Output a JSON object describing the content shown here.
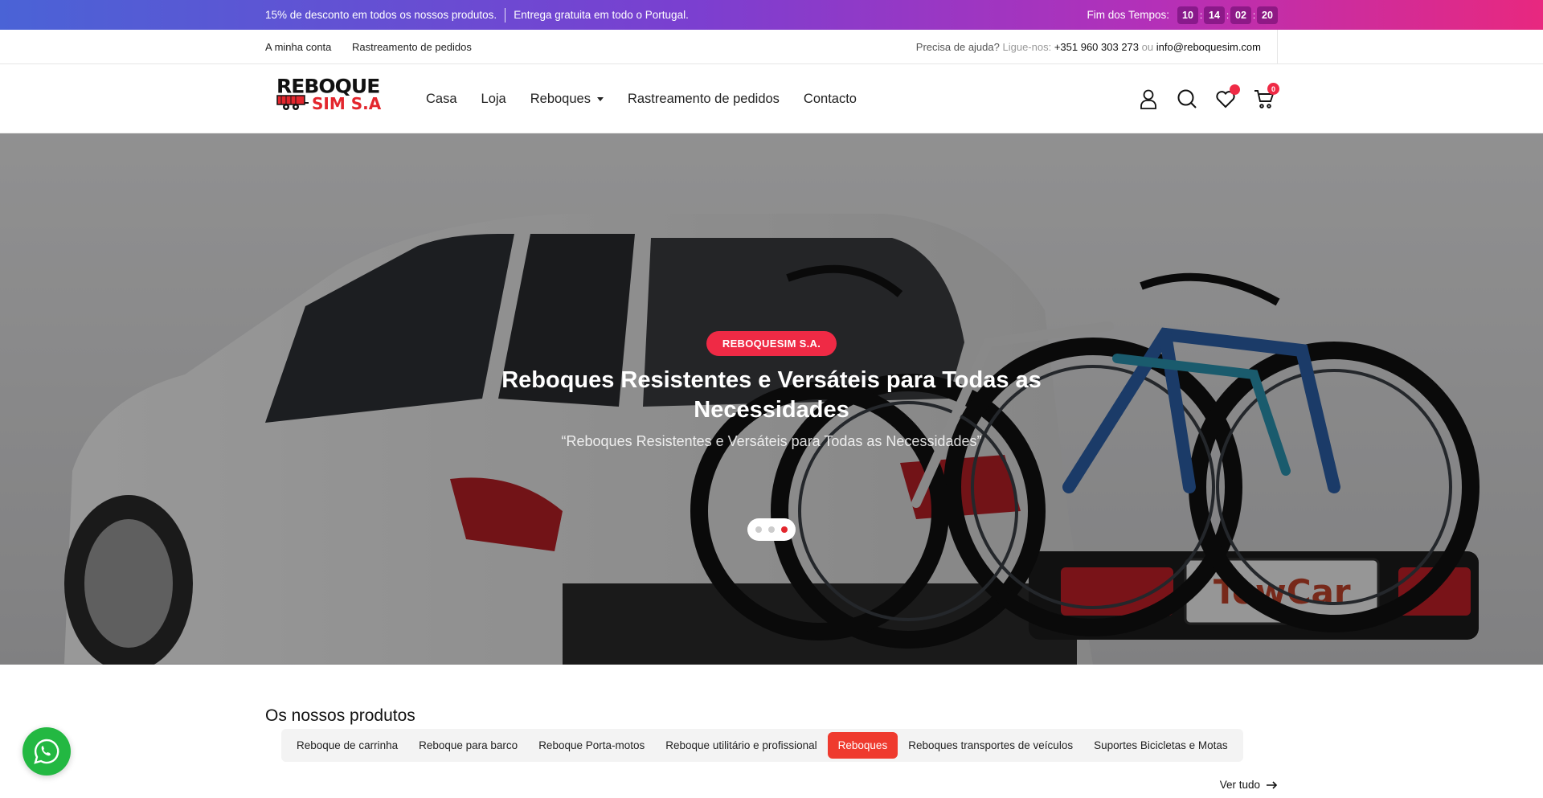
{
  "topbar": {
    "promo1": "15% de desconto em todos os nossos produtos.",
    "promo2": "Entrega gratuita em todo o Portugal.",
    "countdown_label": "Fim dos Tempos:",
    "countdown": [
      "10",
      "14",
      "02",
      "20"
    ]
  },
  "utility": {
    "my_account": "A minha conta",
    "order_tracking": "Rastreamento de pedidos",
    "help_text": "Precisa de ajuda?",
    "call_text": "Ligue-nos:",
    "phone": "+351 960 303 273",
    "or_text": "ou",
    "email": "info@reboquesim.com"
  },
  "header": {
    "logo_line1": "REBOQUE",
    "logo_line2": "SIM S.A",
    "nav": [
      "Casa",
      "Loja",
      "Reboques",
      "Rastreamento de pedidos",
      "Contacto"
    ],
    "cart_count": "0"
  },
  "hero": {
    "badge": "REBOQUESIM S.A.",
    "title": "Reboques Resistentes e Versáteis para Todas as Necessidades",
    "subtitle": "“Reboques Resistentes e Versáteis para Todas as Necessidades”",
    "plate_text": "TowCar",
    "active_slide": 3,
    "slide_count": 3
  },
  "products": {
    "heading": "Os nossos produtos",
    "tabs": [
      "Reboque de carrinha",
      "Reboque para barco",
      "Reboque Porta-motos",
      "Reboque utilitário e profissional",
      "Reboques",
      "Reboques transportes de veículos",
      "Suportes Bicicletas e Motas"
    ],
    "active_tab": "Reboques",
    "view_all": "Ver tudo"
  },
  "colors": {
    "accent": "#ef2a45",
    "active_tab": "#ef3a2e",
    "whatsapp": "#23b842"
  }
}
